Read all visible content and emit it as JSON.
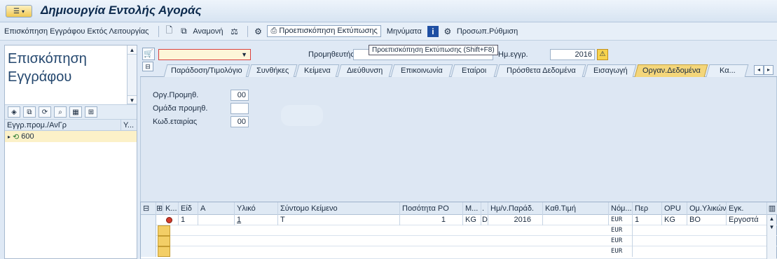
{
  "window": {
    "title": "Δημιουργία Εντολής Αγοράς"
  },
  "toolbar": {
    "doc_overview_off": "Επισκόπηση Εγγράφου Εκτός Λειτουργίας",
    "hold": "Αναμονή",
    "print_preview": "Προεπισκόπηση Εκτύπωσης",
    "messages": "Μηνύματα",
    "personal_setting": "Προσωπ.Ρύθμιση"
  },
  "left_panel": {
    "title_line1": "Επισκόπηση",
    "title_line2": "Εγγράφου",
    "col_doc": "Εγγρ.προμ./ΑνΓρ",
    "col_y": "Υ...",
    "tree_item": "600"
  },
  "header": {
    "vendor_label": "Προμηθευτής",
    "tooltip": "Προεπισκόπηση Εκτύπωσης   (Shift+F8)",
    "date_label": "Ημ.εγγρ.",
    "date_value": "2016"
  },
  "tabs": [
    "Παράδοση/Τιμολόγιο",
    "Συνθήκες",
    "Κείμενα",
    "Διεύθυνση",
    "Επικοινωνία",
    "Εταίροι",
    "Πρόσθετα Δεδομένα",
    "Εισαγωγή",
    "Οργαν.Δεδομένα",
    "Κα..."
  ],
  "org_data": {
    "purch_org_label": "Οργ.Προμηθ.",
    "purch_org_value": "00",
    "purch_group_label": "Ομάδα προμηθ.",
    "purch_group_value": "",
    "company_label": "Κωδ.εταιρίας",
    "company_value": "00"
  },
  "items": {
    "columns": [
      "Κ...",
      "Είδ",
      "Α",
      "Υλικό",
      "Σύντομο Κείμενο",
      "Ποσότητα PO",
      "Μ...",
      ".",
      "Ημ/ν.Παράδ.",
      "Καθ.Τιμή",
      "Νόμ...",
      "Περ",
      "OPU",
      "Ομ.Υλικών",
      "Εγκ."
    ],
    "row1": {
      "item": "1",
      "material": "1",
      "short_text": "T",
      "qty": "1",
      "unit": "KG",
      "d": "D",
      "date": "2016",
      "currency": "EUR",
      "per": "1",
      "opu": "KG",
      "mat_group": "BO",
      "plant": "Εργοστά"
    },
    "empty_currency": "EUR",
    "empty_currency_partial": "EUR"
  }
}
